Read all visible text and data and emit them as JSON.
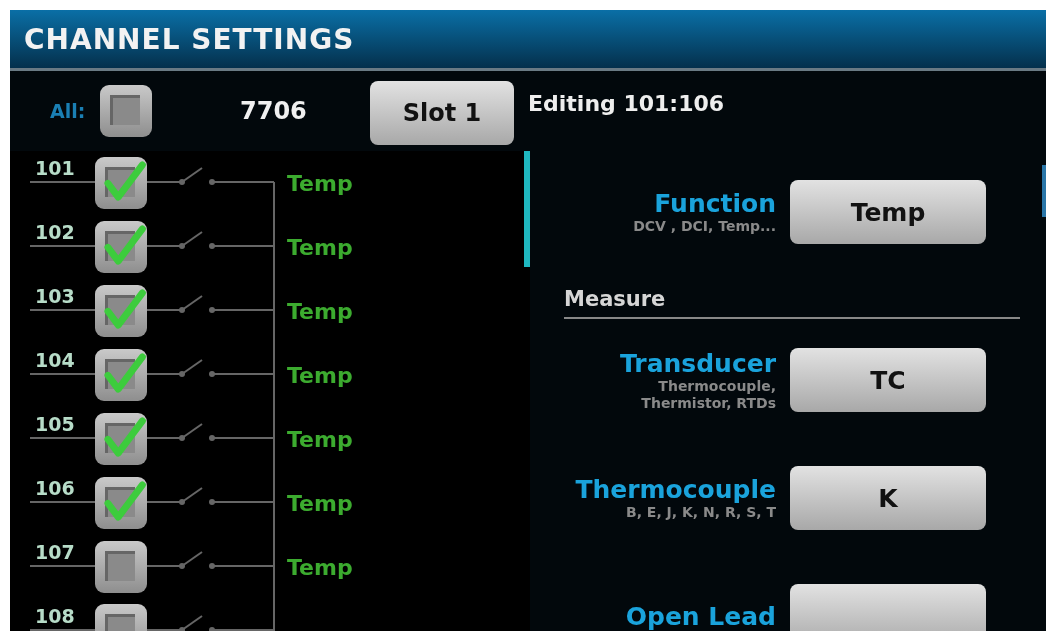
{
  "window": {
    "title": "CHANNEL SETTINGS"
  },
  "toolbar": {
    "all_label": "All:",
    "all_checked": false,
    "card": "7706",
    "slot_button": "Slot 1",
    "editing": "Editing 101:106"
  },
  "channels": [
    {
      "number": "101",
      "checked": true,
      "function": "Temp"
    },
    {
      "number": "102",
      "checked": true,
      "function": "Temp"
    },
    {
      "number": "103",
      "checked": true,
      "function": "Temp"
    },
    {
      "number": "104",
      "checked": true,
      "function": "Temp"
    },
    {
      "number": "105",
      "checked": true,
      "function": "Temp"
    },
    {
      "number": "106",
      "checked": true,
      "function": "Temp"
    },
    {
      "number": "107",
      "checked": false,
      "function": "Temp"
    },
    {
      "number": "108",
      "checked": false
    }
  ],
  "settings": [
    {
      "kind": "setting",
      "label": "Function",
      "hint": "DCV , DCI, Temp...",
      "value": "Temp"
    },
    {
      "kind": "section",
      "label": "Measure"
    },
    {
      "kind": "setting",
      "label": "Transducer",
      "hint": "Thermocouple,\nThermistor, RTDs",
      "value": "TC"
    },
    {
      "kind": "setting",
      "label": "Thermocouple",
      "hint": "B, E, J, K, N, R, S, T",
      "value": "K"
    },
    {
      "kind": "setting",
      "label": "Open Lead"
    }
  ]
}
